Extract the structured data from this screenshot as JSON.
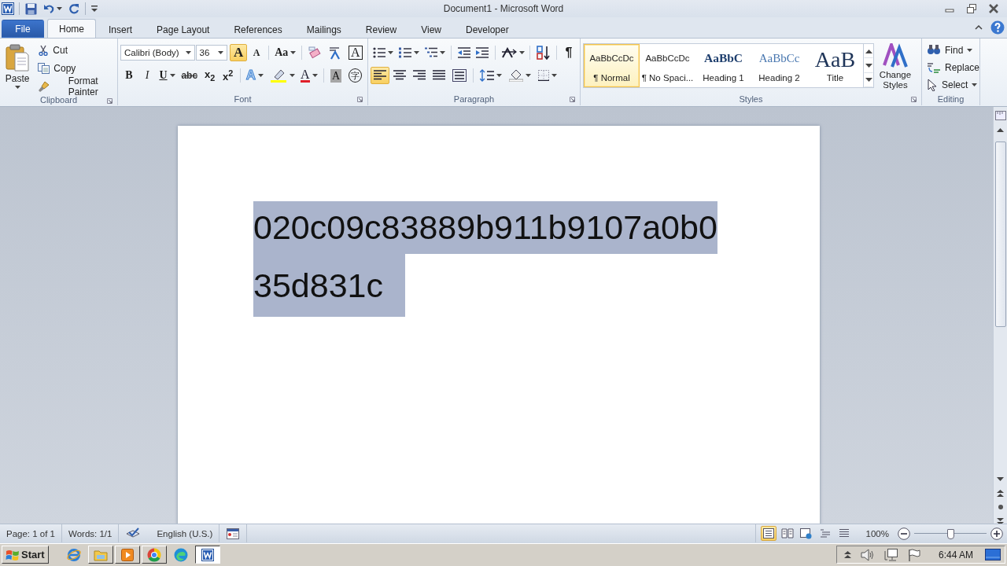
{
  "title_bar": {
    "title": "Document1 - Microsoft Word"
  },
  "tabs": [
    {
      "label": "File",
      "kind": "file",
      "selected": false
    },
    {
      "label": "Home",
      "kind": "tab",
      "selected": true
    },
    {
      "label": "Insert",
      "kind": "tab",
      "selected": false
    },
    {
      "label": "Page Layout",
      "kind": "tab",
      "selected": false
    },
    {
      "label": "References",
      "kind": "tab",
      "selected": false
    },
    {
      "label": "Mailings",
      "kind": "tab",
      "selected": false
    },
    {
      "label": "Review",
      "kind": "tab",
      "selected": false
    },
    {
      "label": "View",
      "kind": "tab",
      "selected": false
    },
    {
      "label": "Developer",
      "kind": "tab",
      "selected": false
    }
  ],
  "ribbon": {
    "clipboard": {
      "label": "Clipboard",
      "paste": "Paste",
      "cut": "Cut",
      "copy": "Copy",
      "format_painter": "Format Painter"
    },
    "font": {
      "label": "Font",
      "font_name": "Calibri (Body)",
      "font_size": "36",
      "row1": [
        {
          "kind": "grow",
          "text": "A",
          "hovered": true
        },
        {
          "kind": "shrink",
          "text": "A",
          "hovered": false
        },
        {
          "kind": "case",
          "text": "Aa",
          "hovered": false
        },
        {
          "kind": "clear",
          "hovered": false
        },
        {
          "kind": "phonetic",
          "hovered": false
        },
        {
          "kind": "char_border",
          "text": "A",
          "hovered": false
        }
      ],
      "row2": [
        {
          "kind": "bold",
          "text": "B",
          "hovered": false
        },
        {
          "kind": "italic",
          "text": "I",
          "hovered": false
        },
        {
          "kind": "underline",
          "text": "U",
          "hovered": false
        },
        {
          "kind": "strike",
          "text": "abc",
          "hovered": false
        },
        {
          "kind": "subscript",
          "text": "x$_{2}$",
          "hovered": false
        },
        {
          "kind": "superscript",
          "text": "x$^{2}$",
          "hovered": false
        },
        {
          "kind": "effects",
          "text": "A",
          "hovered": false
        },
        {
          "kind": "highlight",
          "hovered": false
        },
        {
          "kind": "color",
          "text": "A",
          "hovered": false
        },
        {
          "kind": "shading",
          "text": "A",
          "hovered": false
        },
        {
          "kind": "enclose",
          "text": "字",
          "hovered": false
        }
      ]
    },
    "paragraph": {
      "label": "Paragraph",
      "row1": [
        {
          "kind": "bullets"
        },
        {
          "kind": "numbering"
        },
        {
          "kind": "multilevel"
        },
        {
          "kind": "outdent"
        },
        {
          "kind": "indent"
        },
        {
          "kind": "direction"
        },
        {
          "kind": "sort"
        },
        {
          "kind": "marks",
          "text": "¶"
        }
      ],
      "alignment": [
        {
          "kind": "left",
          "selected": true
        },
        {
          "kind": "center",
          "selected": false
        },
        {
          "kind": "right",
          "selected": false
        },
        {
          "kind": "justify",
          "selected": false
        },
        {
          "kind": "distribute",
          "selected": false
        }
      ],
      "row2": [
        {
          "kind": "line_spacing"
        },
        {
          "kind": "fill"
        },
        {
          "kind": "borders"
        }
      ]
    },
    "styles": {
      "label": "Styles",
      "change_styles": "Change Styles",
      "items": [
        {
          "kind": "normal",
          "preview": "AaBbCcDc",
          "name": "¶ Normal",
          "selected": true
        },
        {
          "kind": "normal",
          "preview": "AaBbCcDc",
          "name": "¶ No Spaci...",
          "selected": false
        },
        {
          "kind": "heading1",
          "preview": "AaBbC",
          "name": "Heading 1",
          "selected": false
        },
        {
          "kind": "heading2",
          "preview": "AaBbCc",
          "name": "Heading 2",
          "selected": false
        },
        {
          "kind": "title",
          "preview": "AaB",
          "name": "Title",
          "selected": false
        }
      ]
    },
    "editing": {
      "label": "Editing",
      "items": [
        {
          "kind": "find",
          "label": "Find"
        },
        {
          "kind": "replace",
          "label": "Replace"
        },
        {
          "kind": "select",
          "label": "Select"
        }
      ]
    }
  },
  "document": {
    "lines": [
      "020c09c83889b911b9107a0b0",
      "35d831c"
    ],
    "selected": true
  },
  "status_bar": {
    "page": "Page: 1 of 1",
    "words": "Words: 1/1",
    "language": "English (U.S.)",
    "views": [
      {
        "kind": "print",
        "selected": true
      },
      {
        "kind": "reading",
        "selected": false
      },
      {
        "kind": "web",
        "selected": false
      },
      {
        "kind": "outline",
        "selected": false
      },
      {
        "kind": "draft",
        "selected": false
      }
    ],
    "zoom": "100%",
    "zoom_slider": {
      "level": 0.5
    }
  },
  "taskbar": {
    "start": "Start",
    "apps": [
      {
        "kind": "ie",
        "running": false,
        "selected": false
      },
      {
        "kind": "explorer",
        "running": true,
        "selected": false
      },
      {
        "kind": "media",
        "running": true,
        "selected": false
      },
      {
        "kind": "chrome",
        "running": true,
        "selected": false
      },
      {
        "kind": "edge",
        "running": false,
        "selected": false
      },
      {
        "kind": "word",
        "running": true,
        "selected": true
      }
    ],
    "clock": "6:44 AM"
  }
}
